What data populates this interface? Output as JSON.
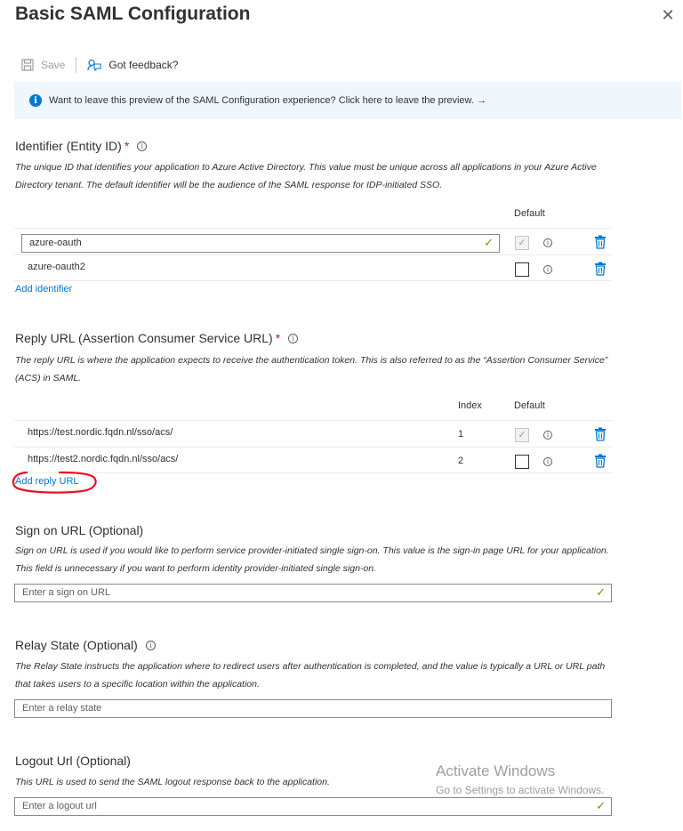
{
  "panel": {
    "title": "Basic SAML Configuration"
  },
  "toolbar": {
    "save_label": "Save",
    "feedback_label": "Got feedback?"
  },
  "banner": {
    "text": "Want to leave this preview of the SAML Configuration experience? Click here to leave the preview. →"
  },
  "identifier": {
    "title": "Identifier (Entity ID)",
    "required_mark": "*",
    "description": "The unique ID that identifies your application to Azure Active Directory. This value must be unique across all applications in your Azure Active Directory tenant. The default identifier will be the audience of the SAML response for IDP-initiated SSO.",
    "col_default": "Default",
    "rows": [
      {
        "value": "azure-oauth",
        "default": true
      },
      {
        "value": "azure-oauth2",
        "default": false
      }
    ],
    "add_label": "Add identifier"
  },
  "reply": {
    "title": "Reply URL (Assertion Consumer Service URL)",
    "required_mark": "*",
    "description": "The reply URL is where the application expects to receive the authentication token. This is also referred to as the “Assertion Consumer Service” (ACS) in SAML.",
    "col_index": "Index",
    "col_default": "Default",
    "rows": [
      {
        "url": "https://test.nordic.fqdn.nl/sso/acs/",
        "index": "1",
        "default": true
      },
      {
        "url": "https://test2.nordic.fqdn.nl/sso/acs/",
        "index": "2",
        "default": false
      }
    ],
    "add_label": "Add reply URL"
  },
  "signon": {
    "title": "Sign on URL (Optional)",
    "description": "Sign on URL is used if you would like to perform service provider-initiated single sign-on. This value is the sign-in page URL for your application. This field is unnecessary if you want to perform identity provider-initiated single sign-on.",
    "placeholder": "Enter a sign on URL"
  },
  "relay": {
    "title": "Relay State (Optional)",
    "description": "The Relay State instructs the application where to redirect users after authentication is completed, and the value is typically a URL or URL path that takes users to a specific location within the application.",
    "placeholder": "Enter a relay state"
  },
  "logout": {
    "title": "Logout Url (Optional)",
    "description": "This URL is used to send the SAML logout response back to the application.",
    "placeholder": "Enter a logout url"
  },
  "watermark": {
    "line1": "Activate Windows",
    "line2": "Go to Settings to activate Windows."
  },
  "colors": {
    "accent": "#0078d4",
    "required": "#a4262c",
    "valid": "#57a300",
    "annotation": "#e81123"
  }
}
